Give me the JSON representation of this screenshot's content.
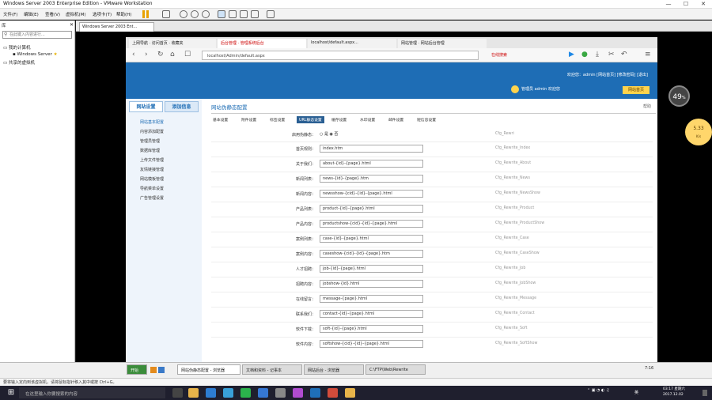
{
  "window": {
    "title": "Windows Server 2003 Enterprise Edition - VMware Workstation",
    "min": "—",
    "max": "☐",
    "close": "✕"
  },
  "menubar": {
    "items": [
      "文件(F)",
      "编辑(E)",
      "查看(V)",
      "虚拟机(M)",
      "选项卡(T)",
      "帮助(H)"
    ]
  },
  "library": {
    "header": "库",
    "search_placeholder": "在此键入内容进行...",
    "tree": {
      "root": "我的计算机",
      "vm": "Windows Server",
      "shared": "共享的虚拟机"
    }
  },
  "vm_tab": {
    "label": "Windows Server 2003 Ent..."
  },
  "browser": {
    "tabs": [
      "上网导航 · 访问首页 · 收藏夹",
      "后台管理 · 管理系统后台",
      "localhost/default.aspx...",
      "网站管理 · 网站后台管理"
    ],
    "url": "localhost/Admin/default.aspx",
    "search_label": "在线搜索"
  },
  "site": {
    "top_links": "欢迎您：admin  [网站首页] [修改密码] [退出]",
    "user_info": "管理员  admin  欢迎您",
    "home_button": "网站首页"
  },
  "sidebar": {
    "tabs": [
      "网站设置",
      "添加信息"
    ],
    "items": [
      "网站基本配置",
      "内容添加配置",
      "管理员管理",
      "数据库管理",
      "上传文件管理",
      "友情链接管理",
      "网站模板管理",
      "导航菜单设置",
      "广告管理设置"
    ]
  },
  "main": {
    "title": "网站伪静态配置",
    "help": "帮助",
    "subtabs": [
      {
        "label": "基本设置",
        "active": false
      },
      {
        "label": "附件设置",
        "active": false
      },
      {
        "label": "标签设置",
        "active": false
      },
      {
        "label": "URL静态设置",
        "active": true
      },
      {
        "label": "缓存设置",
        "active": false
      },
      {
        "label": "水印设置",
        "active": false
      },
      {
        "label": "邮件设置",
        "active": false
      },
      {
        "label": "短信息设置",
        "active": false
      }
    ],
    "toggle": {
      "label": "启用伪静态：",
      "opt_yes": "是",
      "opt_no": "否",
      "var": "Cfg_Rewri"
    },
    "rows": [
      {
        "label": "首页规则：",
        "value": "index.htm",
        "var": "Cfg_Rewrite_Index"
      },
      {
        "label": "关于我们：",
        "value": "about-{id}-{page}.html",
        "var": "Cfg_Rewrite_About"
      },
      {
        "label": "新闻列表：",
        "value": "news-{id}-{page}.htm",
        "var": "Cfg_Rewrite_News"
      },
      {
        "label": "新闻内容：",
        "value": "newsshow-{cid}-{id}-{page}.html",
        "var": "Cfg_Rewrite_NewsShow"
      },
      {
        "label": "产品列表：",
        "value": "product-{id}-{page}.html",
        "var": "Cfg_Rewrite_Product"
      },
      {
        "label": "产品内容：",
        "value": "productshow-{cid}-{id}-{page}.html",
        "var": "Cfg_Rewrite_ProductShow"
      },
      {
        "label": "案例列表：",
        "value": "case-{id}-{page}.html",
        "var": "Cfg_Rewrite_Case"
      },
      {
        "label": "案例内容：",
        "value": "caseshow-{cid}-{id}-{page}.htm",
        "var": "Cfg_Rewrite_CaseShow"
      },
      {
        "label": "人才招聘：",
        "value": "job-{id}-{page}.html",
        "var": "Cfg_Rewrite_Job"
      },
      {
        "label": "招聘内容：",
        "value": "jobshow-{id}.html",
        "var": "Cfg_Rewrite_JobShow"
      },
      {
        "label": "在线留言：",
        "value": "message-{page}.html",
        "var": "Cfg_Rewrite_Message"
      },
      {
        "label": "联系我们：",
        "value": "contact-{id}-{page}.html",
        "var": "Cfg_Rewrite_Contact"
      },
      {
        "label": "软件下载：",
        "value": "soft-{id}-{page}.html",
        "var": "Cfg_Rewrite_Soft"
      },
      {
        "label": "软件内容：",
        "value": "softshow-{cid}-{id}-{page}.html",
        "var": "Cfg_Rewrite_SoftShow"
      }
    ]
  },
  "overlays": {
    "cpu": "49",
    "cpu_unit": "%",
    "speed": "5.33",
    "speed_unit": "K/s"
  },
  "guest_taskbar": {
    "start": "开始",
    "tasks": [
      "网站伪静态配置 - 浏览器",
      "文档和资料 - 记事本",
      "网站后台 - 浏览器",
      "C:\\FTP\\Web\\Rewrite"
    ],
    "time": "7:16"
  },
  "hint": {
    "text": "要将输入定向到该虚拟机，请将鼠标指针移入其中或按 Ctrl+G。"
  },
  "win_taskbar": {
    "search_placeholder": "在这里输入你要搜索的内容",
    "time": "03:17",
    "weekday": "星期六",
    "date": "2017.12.02",
    "tray_lang": "英"
  },
  "colors": {
    "accent": "#1e6db5",
    "active_subtab": "#2a5f93",
    "home_button": "#ffd34d"
  }
}
